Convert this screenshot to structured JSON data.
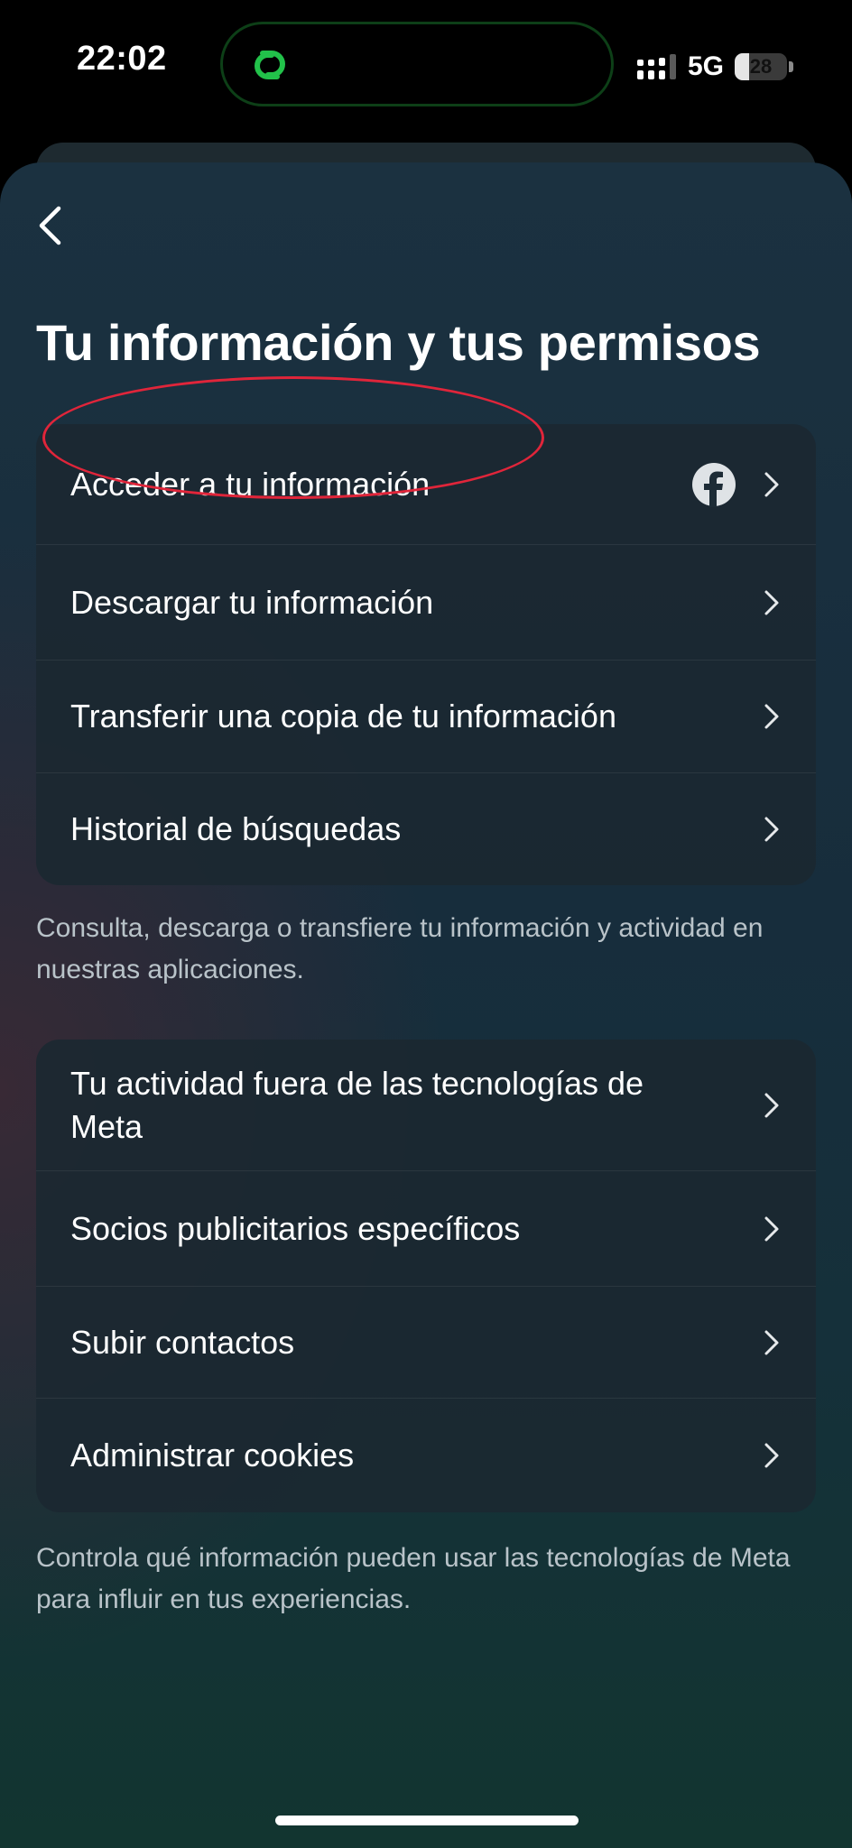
{
  "status_bar": {
    "time": "22:02",
    "network": "5G",
    "battery_level": "28",
    "battery_fraction": 0.28,
    "island_icon": "link-icon",
    "island_icon_color": "#22c24a"
  },
  "page": {
    "title": "Tu información y tus permisos",
    "back_icon": "chevron-left-icon"
  },
  "section1": {
    "items": [
      {
        "label": "Acceder a tu información",
        "trailing_icon": "facebook-icon"
      },
      {
        "label": "Descargar tu información"
      },
      {
        "label": "Transferir una copia de tu información"
      },
      {
        "label": "Historial de búsquedas"
      }
    ],
    "caption": "Consulta, descarga o transfiere tu información y actividad en nuestras aplicaciones."
  },
  "section2": {
    "items": [
      {
        "label": "Tu actividad fuera de las tecnologías de Meta"
      },
      {
        "label": "Socios publicitarios específicos"
      },
      {
        "label": "Subir contactos"
      },
      {
        "label": "Administrar cookies"
      }
    ],
    "caption": "Controla qué información pueden usar las tecnologías de Meta para influir en tus experiencias."
  },
  "annotation": {
    "highlight_color": "#e0253a",
    "highlighted_item": "Descargar tu información"
  }
}
